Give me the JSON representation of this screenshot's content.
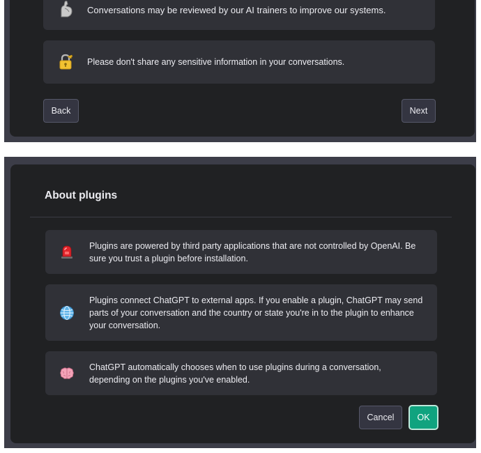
{
  "privacy_step": {
    "items": [
      {
        "icon": "flexed-biceps-icon",
        "text": "Conversations may be reviewed by our AI trainers to improve our systems."
      },
      {
        "icon": "lock-with-key-icon",
        "text": "Please don't share any sensitive information in your conversations."
      }
    ],
    "back_label": "Back",
    "next_label": "Next"
  },
  "about_plugins": {
    "title": "About plugins",
    "items": [
      {
        "icon": "rotating-light-icon",
        "text": "Plugins are powered by third party applications that are not controlled by OpenAI. Be sure you trust a plugin before installation."
      },
      {
        "icon": "globe-icon",
        "text": "Plugins connect ChatGPT to external apps. If you enable a plugin, ChatGPT may send parts of your conversation and the country or state you're in to the plugin to enhance your conversation."
      },
      {
        "icon": "brain-icon",
        "text": "ChatGPT automatically chooses when to use plugins during a conversation, depending on the plugins you've enabled."
      }
    ],
    "cancel_label": "Cancel",
    "ok_label": "OK"
  },
  "colors": {
    "backdrop": "#3c3d48",
    "modal": "#202123",
    "card": "#303137",
    "accent": "#10a37f",
    "text": "#ececf1"
  }
}
